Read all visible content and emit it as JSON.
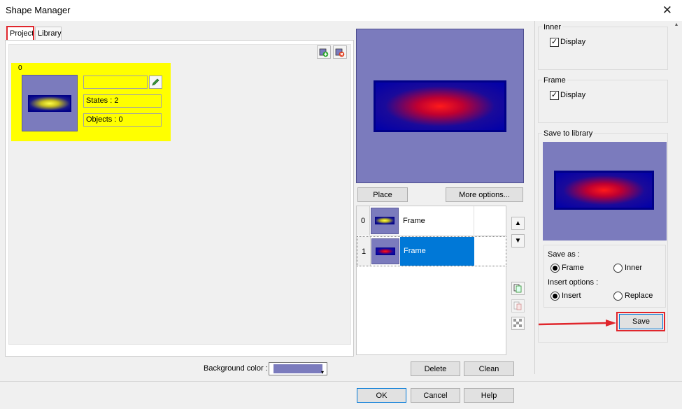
{
  "window": {
    "title": "Shape Manager",
    "close_icon": "close-icon"
  },
  "tabs": [
    {
      "label": "Project",
      "active": true
    },
    {
      "label": "Library",
      "active": false
    }
  ],
  "project": {
    "card": {
      "index": "0",
      "name_value": "",
      "states_label": "States : 2",
      "objects_label": "Objects : 0"
    },
    "toolbar": {
      "add_icon": "add-state-icon",
      "delete_icon": "delete-state-icon"
    }
  },
  "preview": {
    "place_label": "Place",
    "more_options_label": "More options..."
  },
  "states": [
    {
      "index": "0",
      "label": "Frame",
      "selected": false
    },
    {
      "index": "1",
      "label": "Frame",
      "selected": true
    }
  ],
  "list_actions": {
    "delete_label": "Delete",
    "clean_label": "Clean"
  },
  "background": {
    "label": "Background color :",
    "color": "#7b7bbd"
  },
  "inner": {
    "title": "Inner",
    "display_label": "Display",
    "checked": true
  },
  "frame": {
    "title": "Frame",
    "display_label": "Display",
    "checked": true
  },
  "save_library": {
    "title": "Save to library",
    "save_as_label": "Save as :",
    "frame_option": "Frame",
    "inner_option": "Inner",
    "insert_options_label": "Insert options :",
    "insert_option": "Insert",
    "replace_option": "Replace",
    "save_label": "Save"
  },
  "footer": {
    "ok_label": "OK",
    "cancel_label": "Cancel",
    "help_label": "Help"
  },
  "colors": {
    "accent": "#0078d7",
    "highlight": "#ffff00",
    "annotation": "#e0262c",
    "shape_bg": "#7b7bbd"
  }
}
